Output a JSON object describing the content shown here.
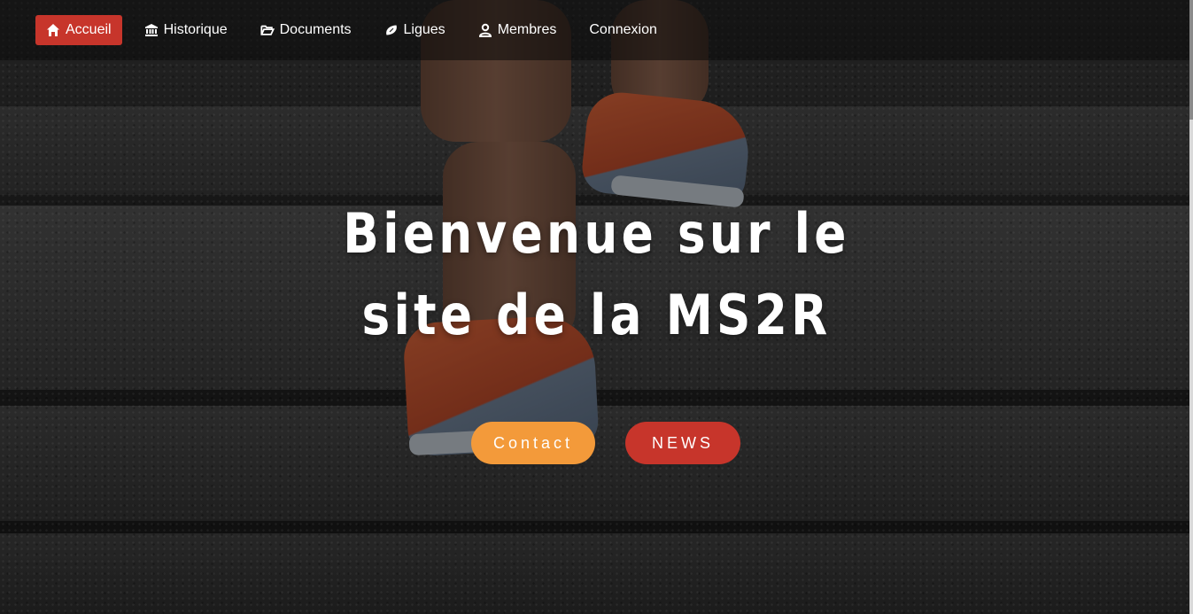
{
  "nav": {
    "items": [
      {
        "label": "Accueil",
        "icon": "home-icon",
        "active": true
      },
      {
        "label": "Historique",
        "icon": "bank-icon",
        "active": false
      },
      {
        "label": "Documents",
        "icon": "folder-icon",
        "active": false
      },
      {
        "label": "Ligues",
        "icon": "football-icon",
        "active": false
      },
      {
        "label": "Membres",
        "icon": "user-icon",
        "active": false
      },
      {
        "label": "Connexion",
        "icon": "",
        "active": false
      }
    ]
  },
  "hero": {
    "title_line1": "Bienvenue sur le",
    "title_line2": "site de la MS2R",
    "contact_label": "Contact",
    "news_label": "NEWS"
  },
  "colors": {
    "accent_red": "#c7352b",
    "accent_orange": "#f39a3a"
  }
}
